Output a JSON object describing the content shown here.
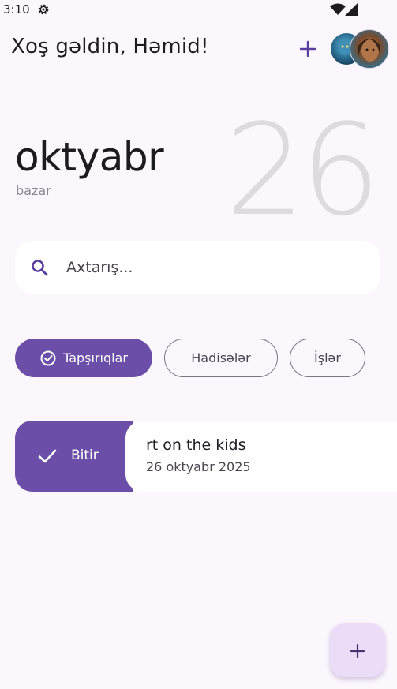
{
  "status_bar": {
    "time": "3:10",
    "icons": [
      "gear-icon",
      "wifi-icon",
      "signal-icon"
    ]
  },
  "header": {
    "greeting": "Xoş gəldin, Həmid!",
    "add_icon": "plus-icon",
    "avatars": [
      "avatar-1",
      "avatar-2"
    ]
  },
  "date": {
    "month": "oktyabr",
    "weekday": "bazar",
    "day": "26"
  },
  "search": {
    "placeholder": "Axtarış...",
    "icon": "search-icon"
  },
  "tabs": [
    {
      "label": "Tapşırıqlar",
      "selected": true,
      "icon": "check-circle-icon"
    },
    {
      "label": "Hadisələr",
      "selected": false
    },
    {
      "label": "İşlər",
      "selected": false
    }
  ],
  "tasks": [
    {
      "swipe_action_label": "Bitir",
      "swipe_action_icon": "check-icon",
      "title": "rt on the kids",
      "date": "26 oktyabr 2025"
    }
  ],
  "fab": {
    "icon": "plus-icon"
  },
  "colors": {
    "background": "#fcf6fd",
    "primary": "#6a4ea8",
    "fab": "#ebdcf8",
    "day_number": "#dedadf"
  }
}
